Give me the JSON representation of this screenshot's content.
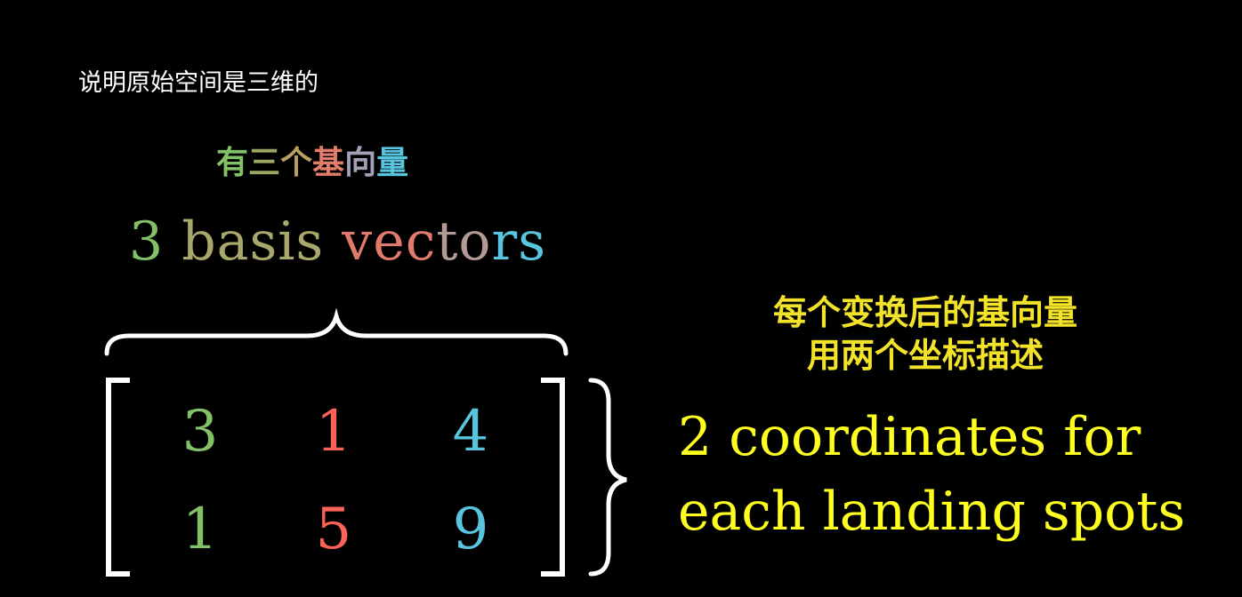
{
  "caption": "说明原始空间是三维的",
  "cn_title": [
    {
      "text": "有",
      "color": "#83c167"
    },
    {
      "text": "三",
      "color": "#9aa864"
    },
    {
      "text": "个",
      "color": "#b9a05e"
    },
    {
      "text": "基",
      "color": "#e27c6b"
    },
    {
      "text": "向",
      "color": "#a4a0b8"
    },
    {
      "text": "量",
      "color": "#58c4dd"
    }
  ],
  "en_title": [
    {
      "text": "3",
      "color": "#83c167"
    },
    {
      "text": " ",
      "color": "#83c167"
    },
    {
      "text": "basis",
      "color": "#a8a86c"
    },
    {
      "text": " ",
      "color": "#a8a86c"
    },
    {
      "text": "vec",
      "color": "#e07a6c"
    },
    {
      "text": "to",
      "color": "#b49a96"
    },
    {
      "text": "rs",
      "color": "#58c4dd"
    }
  ],
  "matrix": {
    "rows": [
      [
        {
          "value": "3",
          "color": "#83c167"
        },
        {
          "value": "1",
          "color": "#fc6255"
        },
        {
          "value": "4",
          "color": "#58c4dd"
        }
      ],
      [
        {
          "value": "1",
          "color": "#83c167"
        },
        {
          "value": "5",
          "color": "#fc6255"
        },
        {
          "value": "9",
          "color": "#58c4dd"
        }
      ]
    ]
  },
  "right_cn": {
    "line1": "每个变换后的基向量",
    "line2": "用两个坐标描述"
  },
  "right_en": {
    "line1": "2 coordinates for",
    "line2": "each landing spots"
  },
  "colors": {
    "background": "#000000",
    "bracket": "#ffffff",
    "highlight": "#ffff1f"
  }
}
